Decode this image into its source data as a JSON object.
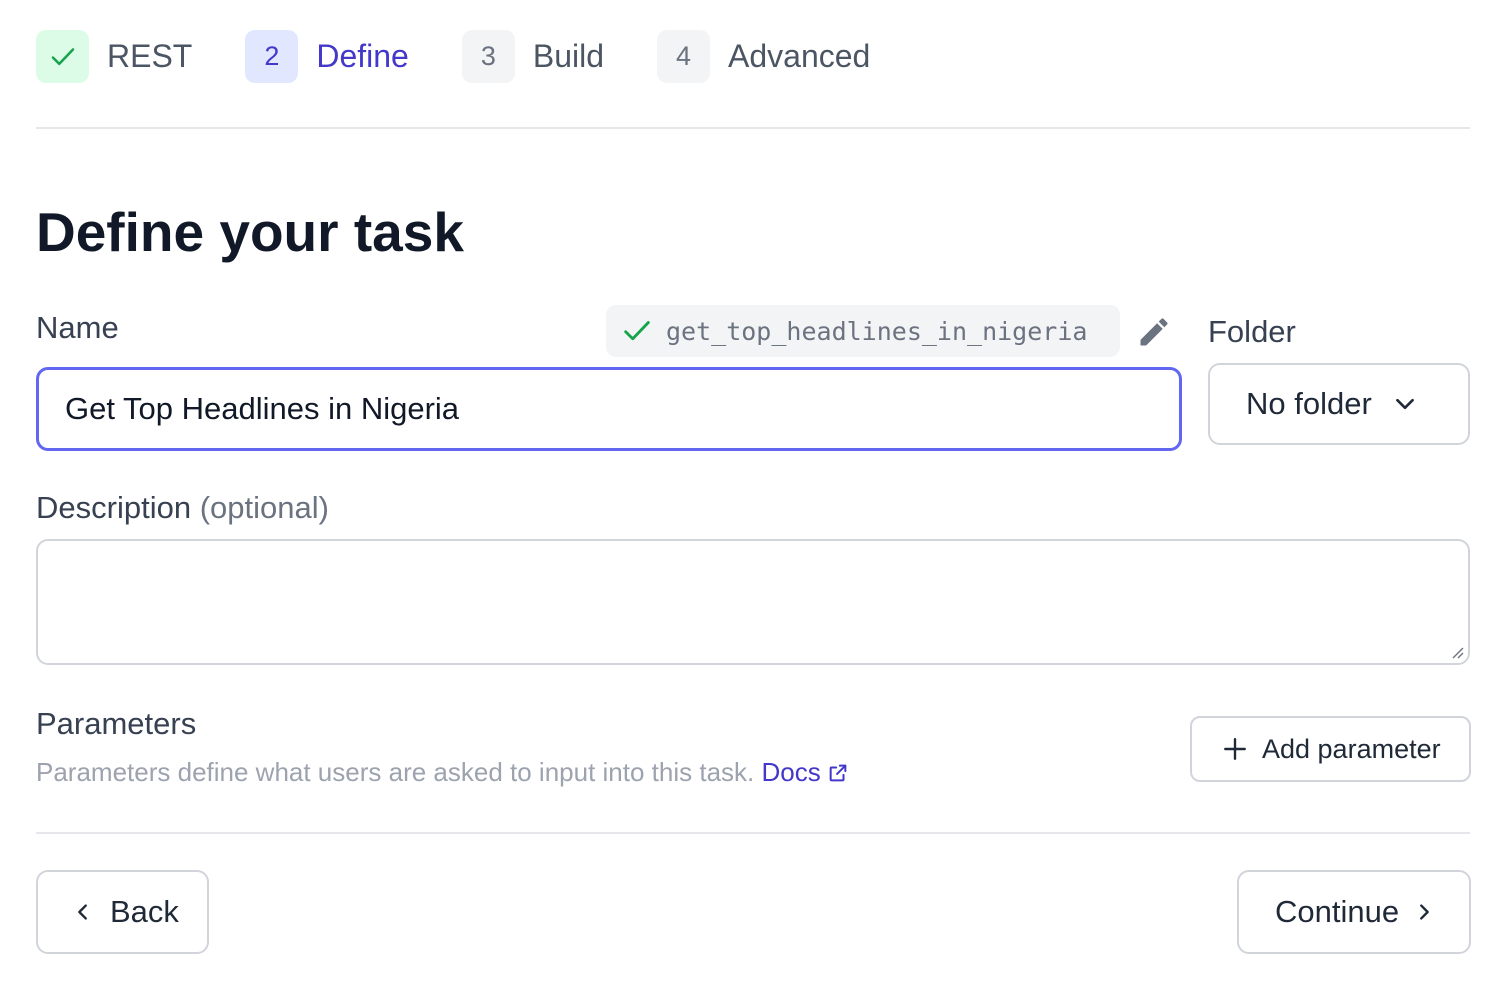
{
  "stepper": {
    "steps": [
      {
        "badge": "",
        "label": "REST",
        "state": "done"
      },
      {
        "badge": "2",
        "label": "Define",
        "state": "active"
      },
      {
        "badge": "3",
        "label": "Build",
        "state": "upcoming"
      },
      {
        "badge": "4",
        "label": "Advanced",
        "state": "upcoming"
      }
    ]
  },
  "page": {
    "title": "Define your task"
  },
  "name_field": {
    "label": "Name",
    "value": "Get Top Headlines in Nigeria",
    "slug": "get_top_headlines_in_nigeria",
    "slug_status_icon": "check-icon",
    "edit_icon": "pencil-icon"
  },
  "folder_field": {
    "label": "Folder",
    "value": "No folder",
    "icon": "chevron-down-icon"
  },
  "description_field": {
    "label": "Description",
    "optional_text": "(optional)",
    "value": ""
  },
  "parameters": {
    "title": "Parameters",
    "help_text": "Parameters define what users are asked to input into this task.",
    "docs_link": "Docs",
    "add_button": "Add parameter"
  },
  "footer": {
    "back_label": "Back",
    "continue_label": "Continue"
  },
  "colors": {
    "accent": "#4338ca",
    "focus_border": "#6366f1",
    "success": "#16a34a",
    "success_bg": "#dcfce7",
    "muted_text": "#9ca3af",
    "border": "#d1d5db"
  }
}
